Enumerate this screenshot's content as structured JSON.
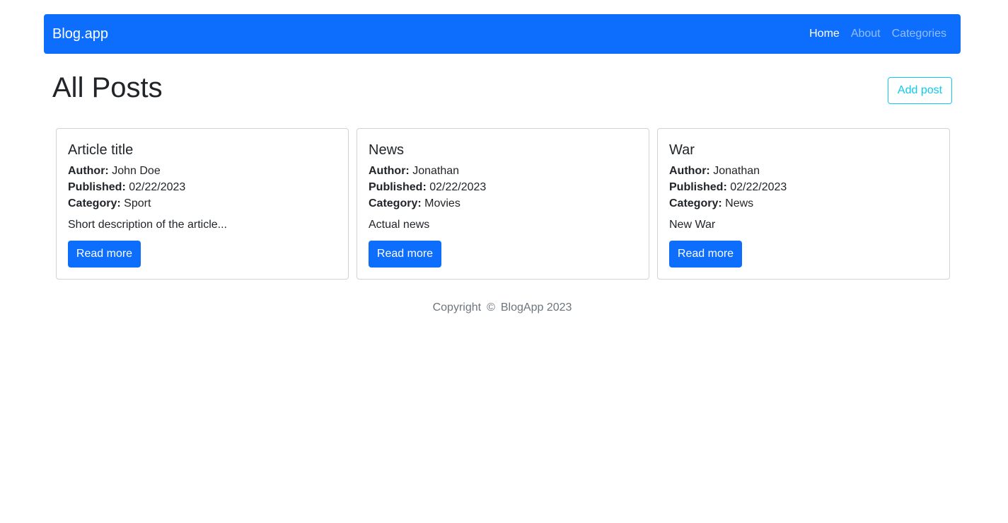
{
  "navbar": {
    "brand": "Blog.app",
    "links": [
      {
        "label": "Home",
        "active": true
      },
      {
        "label": "About",
        "active": false
      },
      {
        "label": "Categories",
        "active": false
      }
    ]
  },
  "main": {
    "title": "All Posts",
    "add_button": "Add post"
  },
  "labels": {
    "author": "Author:",
    "published": "Published:",
    "category": "Category:",
    "read_more": "Read more"
  },
  "posts": [
    {
      "title": "Article title",
      "author": "John Doe",
      "published": "02/22/2023",
      "category": "Sport",
      "description": "Short description of the article..."
    },
    {
      "title": "News",
      "author": "Jonathan",
      "published": "02/22/2023",
      "category": "Movies",
      "description": "Actual news"
    },
    {
      "title": "War",
      "author": "Jonathan",
      "published": "02/22/2023",
      "category": "News",
      "description": "New War"
    }
  ],
  "footer": {
    "prefix": "Copyright",
    "symbol": "©",
    "suffix": "BlogApp 2023"
  },
  "colors": {
    "primary": "#0d6efd",
    "info": "#0dcaf0",
    "muted": "#6c757d"
  }
}
